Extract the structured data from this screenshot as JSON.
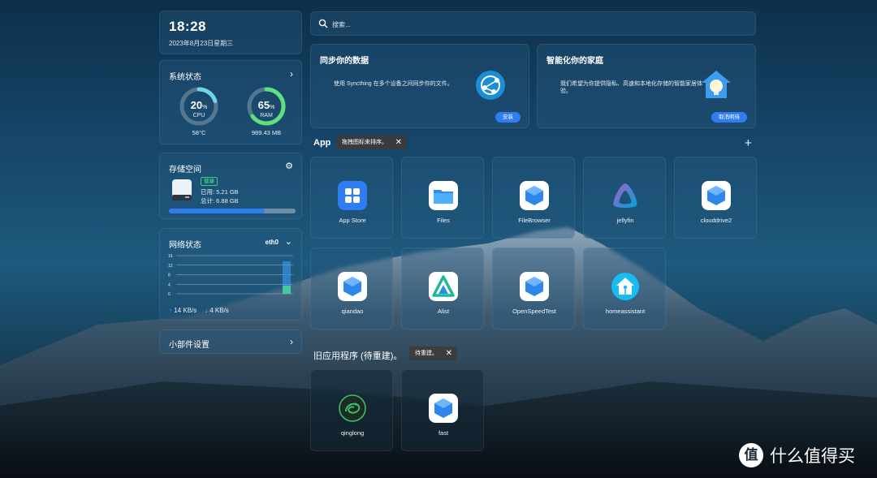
{
  "clock": {
    "time": "18:28",
    "date": "2023年8月23日星期三"
  },
  "system_status": {
    "title": "系统状态",
    "cpu": {
      "percent": 20,
      "percent_text": "20",
      "unit": "%",
      "label": "CPU",
      "detail": "58°C"
    },
    "ram": {
      "percent": 65,
      "percent_text": "65",
      "unit": "%",
      "label": "RAM",
      "detail": "989.43 MB"
    }
  },
  "storage": {
    "title": "存储空间",
    "health": "健康",
    "used": "已用: 5.21 GB",
    "total": "总计: 6.88 GB",
    "used_fraction": 0.757
  },
  "network": {
    "title": "网络状态",
    "interface": "eth0",
    "y_ticks": [
      "16",
      "12",
      "8",
      "4",
      "0"
    ],
    "upload": "14 KB/s",
    "download": "4 KB/s"
  },
  "widget_settings": {
    "label": "小部件设置"
  },
  "search": {
    "placeholder": "搜索..."
  },
  "promos": [
    {
      "title": "同步你的数据",
      "desc": "使用 Syncthing 在多个设备之间同步你的文件。",
      "button": "安装"
    },
    {
      "title": "智能化你的家庭",
      "desc": "我们希望为你提供隐私、高速和本地化存储的智能家居体验。",
      "button": "取消明待"
    }
  ],
  "apps_section": {
    "title": "App",
    "tip": "拖拽图标来排序。",
    "tip_close": "✕",
    "add": "+"
  },
  "apps": [
    {
      "name": "App Store",
      "icon": "app-store-icon"
    },
    {
      "name": "Files",
      "icon": "folder-icon"
    },
    {
      "name": "FileBrowser",
      "icon": "cube-icon"
    },
    {
      "name": "jellyfin",
      "icon": "jellyfin-icon"
    },
    {
      "name": "clouddrive2",
      "icon": "cube-icon"
    },
    {
      "name": "qiandao",
      "icon": "cube-icon"
    },
    {
      "name": "Alist",
      "icon": "alist-icon"
    },
    {
      "name": "OpenSpeedTest",
      "icon": "cube-icon"
    },
    {
      "name": "homeassistant",
      "icon": "home-assistant-icon"
    }
  ],
  "legacy_section": {
    "title": "旧应用程序 (待重建)。",
    "tip": "待重建。",
    "tip_close": "✕"
  },
  "legacy_apps": [
    {
      "name": "qinglong",
      "icon": "qinglong-icon"
    },
    {
      "name": "fast",
      "icon": "cube-icon"
    }
  ],
  "watermark": {
    "text": "什么值得买",
    "logo_char": "值"
  },
  "colors": {
    "accent": "#2f7df0",
    "health": "#3fcf7c",
    "cpu_ring": "#6fd6e6",
    "ram_ring": "#5ee07a"
  }
}
